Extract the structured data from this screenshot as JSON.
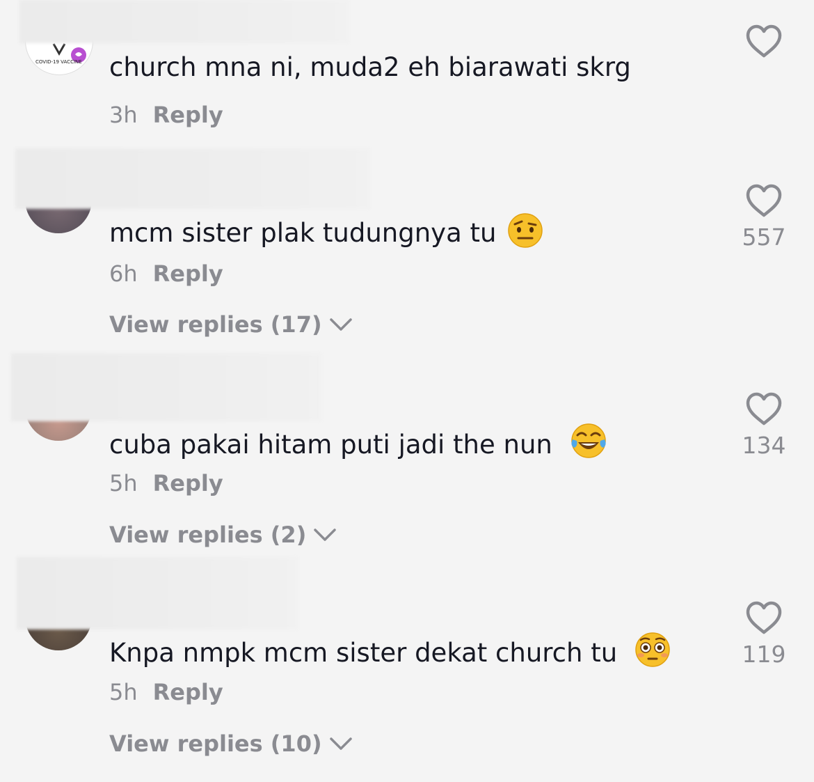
{
  "comments": [
    {
      "text": "church mna ni, muda2 eh biarawati skrg",
      "time": "3h",
      "reply": "Reply",
      "likes": "",
      "view_replies": "",
      "emoji": "",
      "badge_text": "COVID-19 VACCINE"
    },
    {
      "text": "mcm sister plak tudungnya tu",
      "time": "6h",
      "reply": "Reply",
      "likes": "557",
      "view_replies": "View replies (17)",
      "emoji": "raised-eyebrow-emoji"
    },
    {
      "text": "cuba pakai hitam puti jadi the nun",
      "time": "5h",
      "reply": "Reply",
      "likes": "134",
      "view_replies": "View replies (2)",
      "emoji": "tears-of-joy-emoji"
    },
    {
      "text": "Knpa nmpk mcm sister dekat church tu",
      "time": "5h",
      "reply": "Reply",
      "likes": "119",
      "view_replies": "View replies (10)",
      "emoji": "flushed-emoji"
    }
  ],
  "colors": {
    "background": "#f4f4f4",
    "text": "#161823",
    "muted": "#8a8b91"
  }
}
